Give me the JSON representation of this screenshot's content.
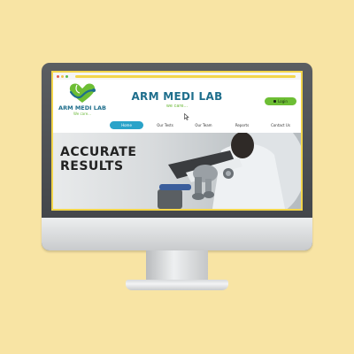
{
  "site": {
    "logo_name": "ARM MEDI LAB",
    "logo_tagline": "We care...",
    "title": "ARM MEDI LAB",
    "tagline": "we care...",
    "login_label": "Login"
  },
  "nav": {
    "items": [
      {
        "label": "Home",
        "active": true
      },
      {
        "label": "Our Tests",
        "active": false
      },
      {
        "label": "Our Team",
        "active": false
      },
      {
        "label": "Reports",
        "active": false
      },
      {
        "label": "Contact Us",
        "active": false
      }
    ]
  },
  "hero": {
    "line1": "ACCURATE",
    "line2": "RESULTS"
  },
  "colors": {
    "background": "#f8e4a4",
    "brand_teal": "#1e6e8c",
    "brand_green": "#6dbe34",
    "nav_active": "#2aa3c9",
    "screen_border": "#f2d54b"
  },
  "icons": [
    "heart-stethoscope-logo-icon",
    "lock-icon",
    "mouse-cursor-icon"
  ]
}
